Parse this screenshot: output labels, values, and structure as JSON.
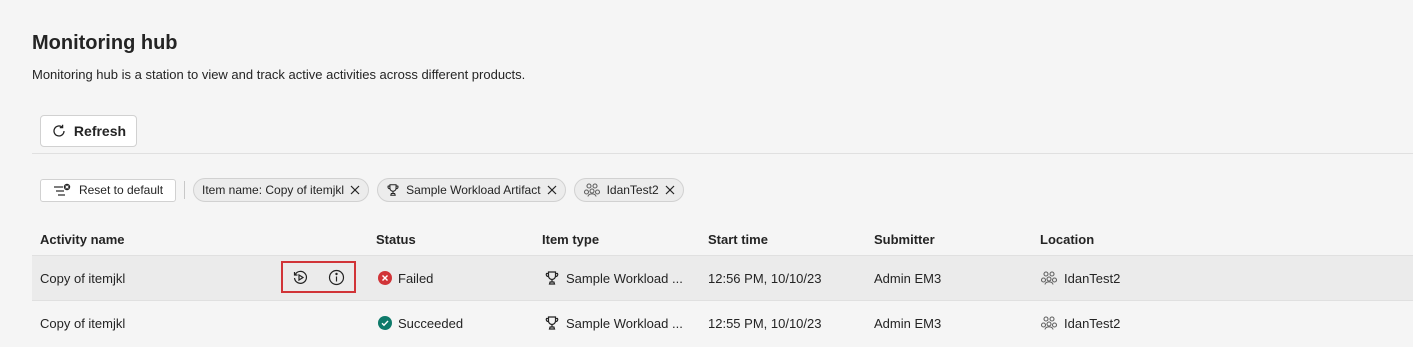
{
  "header": {
    "title": "Monitoring hub",
    "subtitle": "Monitoring hub is a station to view and track active activities across different products."
  },
  "toolbar": {
    "refresh_label": "Refresh",
    "refresh_icon": "refresh-icon"
  },
  "filters": {
    "reset_label": "Reset to default",
    "chips": [
      {
        "label": "Item name: Copy of itemjkl",
        "icon": ""
      },
      {
        "label": "Sample Workload Artifact",
        "icon": "trophy-icon"
      },
      {
        "label": "IdanTest2",
        "icon": "workspace-icon"
      }
    ]
  },
  "table": {
    "columns": [
      "Activity name",
      "Status",
      "Item type",
      "Start time",
      "Submitter",
      "Location"
    ],
    "rows": [
      {
        "activity": "Copy of itemjkl",
        "status": "Failed",
        "status_color": "#d13438",
        "item_type": "Sample Workload ...",
        "start_time": "12:56 PM, 10/10/23",
        "submitter": "Admin EM3",
        "location": "IdanTest2",
        "actions": [
          "rerun-icon",
          "info-icon"
        ]
      },
      {
        "activity": "Copy of itemjkl",
        "status": "Succeeded",
        "status_color": "#0e7a6a",
        "item_type": "Sample Workload ...",
        "start_time": "12:55 PM, 10/10/23",
        "submitter": "Admin EM3",
        "location": "IdanTest2"
      }
    ]
  },
  "colors": {
    "highlight_box": "#d13438",
    "failed": "#d13438",
    "succeeded": "#0e7a6a"
  }
}
